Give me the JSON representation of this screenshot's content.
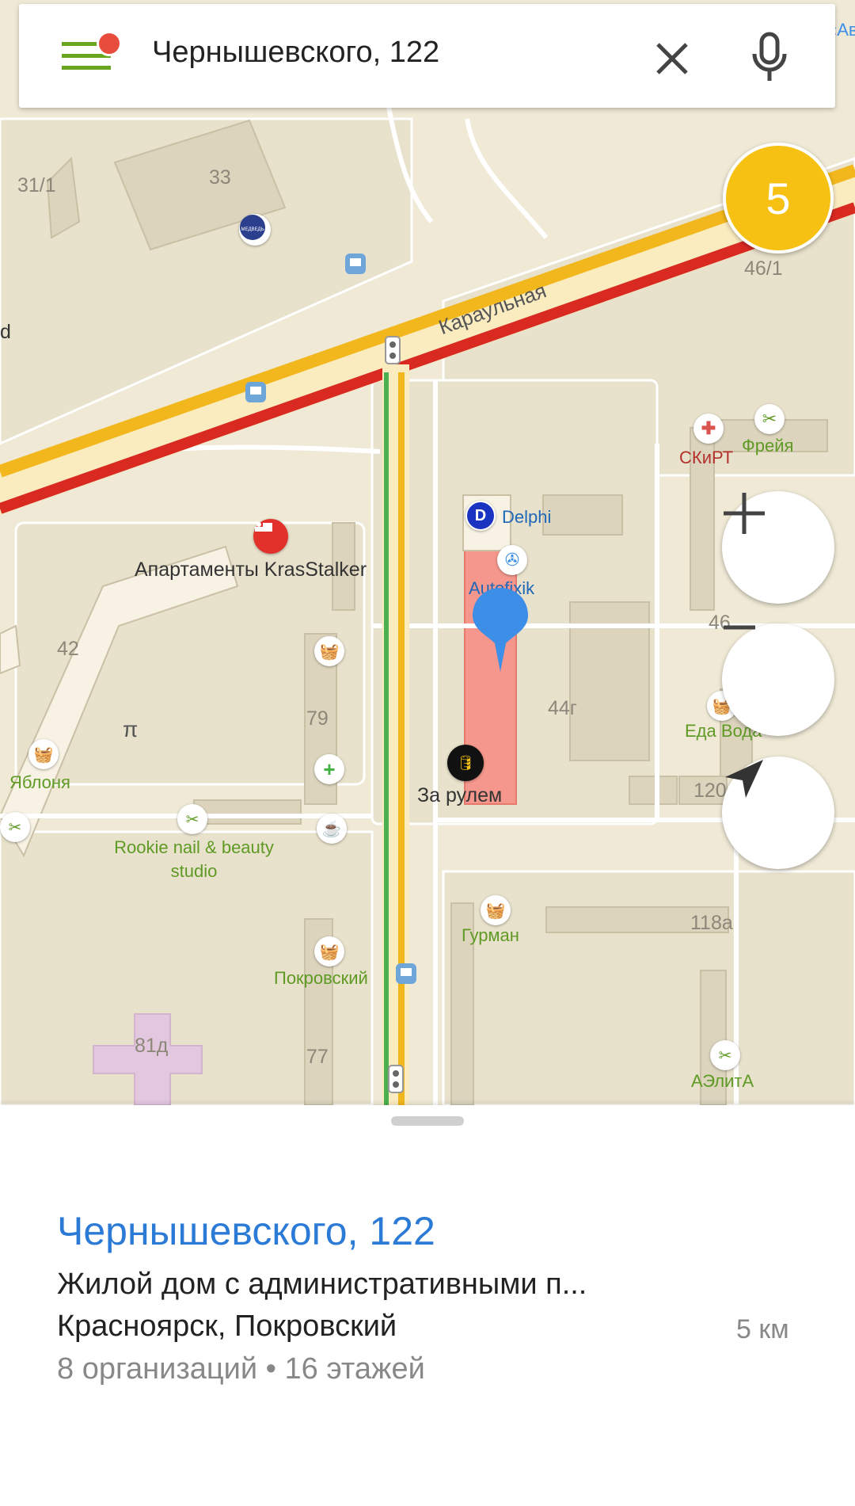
{
  "search": {
    "query": "Чернышевского, 122"
  },
  "traffic_score": "5",
  "map": {
    "street_labels": [
      "Караульная"
    ],
    "house_numbers": [
      "33",
      "31/1",
      "46/1",
      "42",
      "79",
      "44г",
      "46",
      "120",
      "118а",
      "77",
      "81д"
    ],
    "pois": {
      "medved": "МЕДВЕДЬ",
      "apartments": "Апартаменты KrasStalker",
      "delphi": "Delphi",
      "autofixik": "Autofixik",
      "zarulem": "За рулем",
      "skirt": "СКиРТ",
      "freya": "Фрейя",
      "eda_voda": "Еда Вода",
      "yablonya": "Яблоня",
      "rookie": "Rookie nail & beauty studio",
      "gurman": "Гурман",
      "pokrovsky": "Покровский",
      "aelita": "АЭлитА"
    },
    "edge_labels": {
      "top_right": "«Ав",
      "left_mid": "d"
    }
  },
  "panel": {
    "title": "Чернышевского, 122",
    "description": "Жилой дом с административными п...",
    "address": "Красноярск, Покровский",
    "distance": "5 км",
    "organizations": "8 организаций",
    "separator": "•",
    "floors": "16 этажей"
  },
  "colors": {
    "traffic_yellow": "#f6c112",
    "road_red": "#d92a22",
    "road_yellow": "#f2b71c",
    "road_green": "#4caf50",
    "menu_green": "#6aa51f",
    "notification_dot": "#e74c3c",
    "pin_blue": "#3d8ee6",
    "building_highlight": "#f5978c",
    "title_blue": "#2b7bd6"
  },
  "icons": [
    "menu-icon",
    "clear-icon",
    "microphone-icon",
    "zoom-in-icon",
    "zoom-out-icon",
    "location-arrow-icon",
    "selected-pin-icon"
  ]
}
